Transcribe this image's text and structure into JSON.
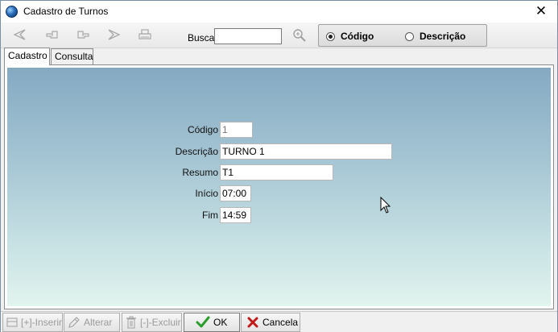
{
  "window": {
    "title": "Cadastro de Turnos",
    "close_label": "✕"
  },
  "toolbar": {
    "busca_label": "Busca",
    "busca_value": "",
    "radio_codigo": "Código",
    "radio_descricao": "Descrição",
    "selected": "codigo"
  },
  "tabs": [
    {
      "label": "Cadastro",
      "active": true
    },
    {
      "label": "Consulta",
      "active": false
    }
  ],
  "form": {
    "codigo_label": "Código",
    "codigo_value": "1",
    "descricao_label": "Descrição",
    "descricao_value": "TURNO 1",
    "resumo_label": "Resumo",
    "resumo_value": "T1",
    "inicio_label": "Início",
    "inicio_value": "07:00",
    "fim_label": "Fim",
    "fim_value": "14:59"
  },
  "bottom": {
    "inserir_label": "[+]-Inserir",
    "alterar_label": "Alterar",
    "excluir_label": "[-]-Excluir",
    "ok_label": "OK",
    "cancela_label": "Cancela"
  },
  "colors": {
    "ok_check": "#2a9d2a",
    "cancel_x": "#c21a1a"
  }
}
